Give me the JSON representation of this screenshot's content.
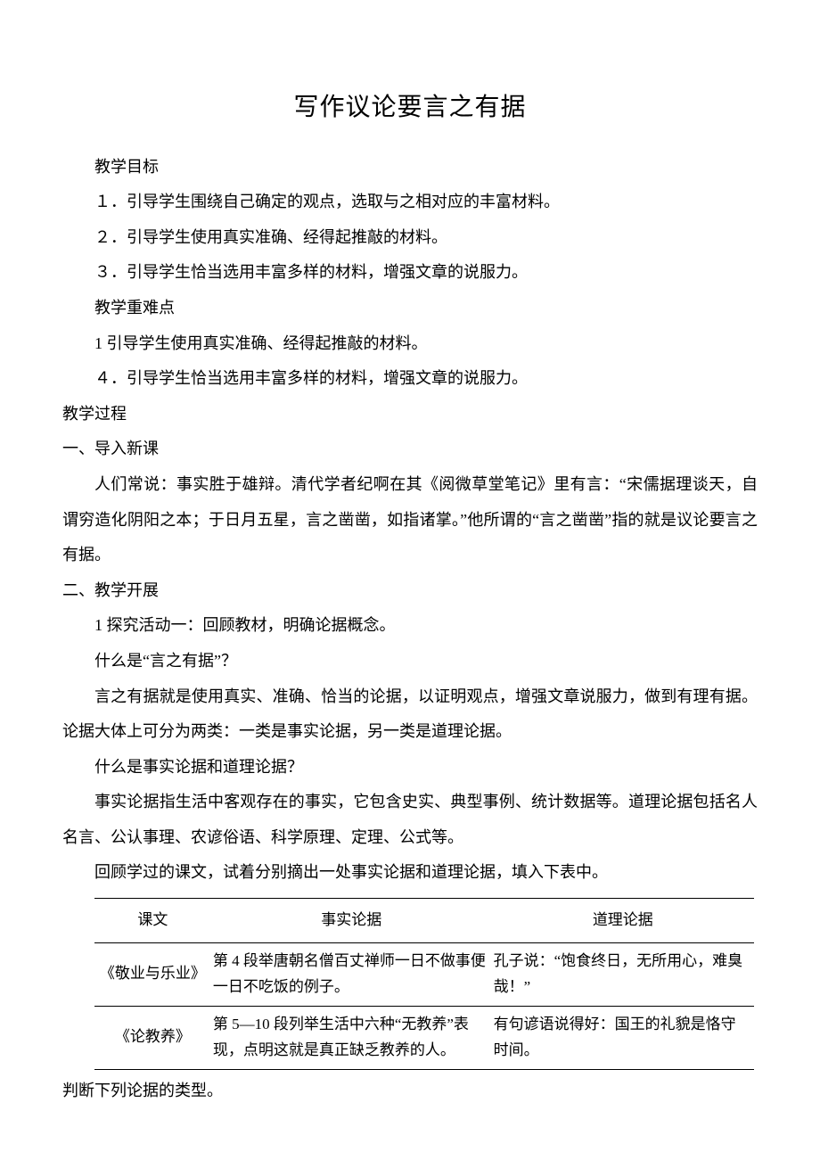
{
  "title": "写作议论要言之有据",
  "sections": {
    "goals_heading": "教学目标",
    "goal1": "１．引导学生围绕自己确定的观点，选取与之相对应的丰富材料。",
    "goal2": "２．引导学生使用真实准确、经得起推敲的材料。",
    "goal3": "３．引导学生恰当选用丰富多样的材料，增强文章的说服力。",
    "difficulty_heading": "教学重难点",
    "diff1": "1 引导学生使用真实准确、经得起推敲的材料。",
    "diff2": "４．引导学生恰当选用丰富多样的材料，增强文章的说服力。",
    "process_heading": "教学过程",
    "intro_heading": "一、导入新课",
    "intro_p": "人们常说：事实胜于雄辩。清代学者纪啊在其《阅微草堂笔记》里有言：“宋儒据理谈天，自谓穷造化阴阳之本；于日月五星，言之凿凿，如指诸掌。”他所谓的“言之凿凿”指的就是议论要言之有据。",
    "expand_heading": "二、教学开展",
    "activity1": "1 探究活动一：回顾教材，明确论据概念。",
    "q1": "什么是“言之有据”？",
    "a1": "言之有据就是使用真实、准确、恰当的论据，以证明观点，增强文章说服力，做到有理有据。论据大体上可分为两类：一类是事实论据，另一类是道理论据。",
    "q2": "什么是事实论据和道理论据？",
    "a2": "事实论据指生活中客观存在的事实，它包含史实、典型事例、统计数据等。道理论据包括名人名言、公认事理、农谚俗语、科学原理、定理、公式等。",
    "task": "回顾学过的课文，试着分别摘出一处事实论据和道理论据，填入下表中。",
    "after_table": "判断下列论据的类型。"
  },
  "table": {
    "headers": {
      "col1": "课文",
      "col2": "事实论据",
      "col3": "道理论据"
    },
    "rows": [
      {
        "title": "《敬业与乐业》",
        "fact": "第 4 段举唐朝名僧百丈禅师一日不做事便一日不吃饭的例子。",
        "reason": "孔子说：“饱食终日，无所用心，难臭哉！”"
      },
      {
        "title": "《论教养》",
        "fact": "第 5—10 段列举生活中六种“无教养”表现，点明这就是真正缺乏教养的人。",
        "reason": "有句谚语说得好：国王的礼貌是恪守时间。"
      }
    ]
  }
}
